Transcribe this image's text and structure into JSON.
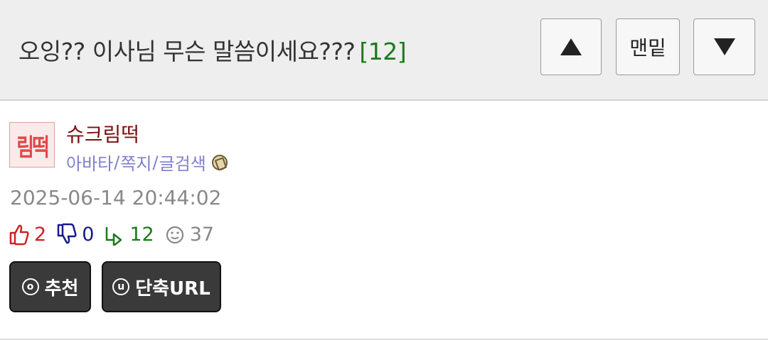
{
  "header": {
    "title": "오잉?? 이사님 무슨 말씀이세요???",
    "comment_count": "[12]",
    "nav": {
      "up_icon": "triangle-up-icon",
      "bottom_label": "맨밑",
      "down_icon": "triangle-down-icon"
    }
  },
  "author": {
    "avatar_text": "림떡",
    "nickname": "슈크림떡",
    "links": [
      "아바타",
      "쪽지",
      "글검색"
    ],
    "link_separator": "/",
    "badge_icon": "level-badge-icon"
  },
  "post": {
    "date": "2025-06-14 20:44:02",
    "stats": {
      "upvotes": "2",
      "downvotes": "0",
      "replies": "12",
      "views": "37"
    }
  },
  "actions": {
    "recommend_icon": "o",
    "recommend_label": "추천",
    "shorturl_icon": "u",
    "shorturl_label": "단축URL"
  },
  "colors": {
    "header_bg": "#eeeeee",
    "comment_count": "#1a7a1a",
    "nickname": "#7a1010",
    "links": "#8080cc",
    "upvote": "#cc2222",
    "downvote": "#1a1a8a",
    "reply": "#1a7a1a",
    "button_bg": "#3a3a3a"
  }
}
